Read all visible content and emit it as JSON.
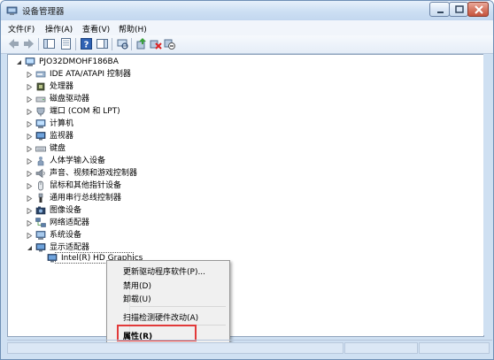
{
  "window": {
    "title": "设备管理器"
  },
  "menubar": {
    "items": [
      "文件(F)",
      "操作(A)",
      "查看(V)",
      "帮助(H)"
    ]
  },
  "toolbar": {
    "buttons": [
      "back-icon",
      "forward-icon",
      "show-hide-console-tree-icon",
      "properties-sheet-icon",
      "help-icon",
      "action-pane-icon",
      "scan-hardware-icon",
      "update-driver-icon",
      "uninstall-icon",
      "disable-icon"
    ]
  },
  "tree": {
    "root": "PJO32DMOHF186BA",
    "categories": [
      "IDE ATA/ATAPI 控制器",
      "处理器",
      "磁盘驱动器",
      "端口 (COM 和 LPT)",
      "计算机",
      "监视器",
      "键盘",
      "人体学输入设备",
      "声音、视频和游戏控制器",
      "鼠标和其他指针设备",
      "通用串行总线控制器",
      "图像设备",
      "网络适配器",
      "系统设备",
      "显示适配器"
    ],
    "display_adapter_child": "Intel(R) HD Graphics"
  },
  "context_menu": {
    "update_driver": "更新驱动程序软件(P)...",
    "disable": "禁用(D)",
    "uninstall": "卸载(U)",
    "scan": "扫描检测硬件改动(A)",
    "properties": "属性(R)"
  },
  "colors": {
    "highlight_border": "#e23a3a",
    "window_frame": "#cfe0f2"
  }
}
